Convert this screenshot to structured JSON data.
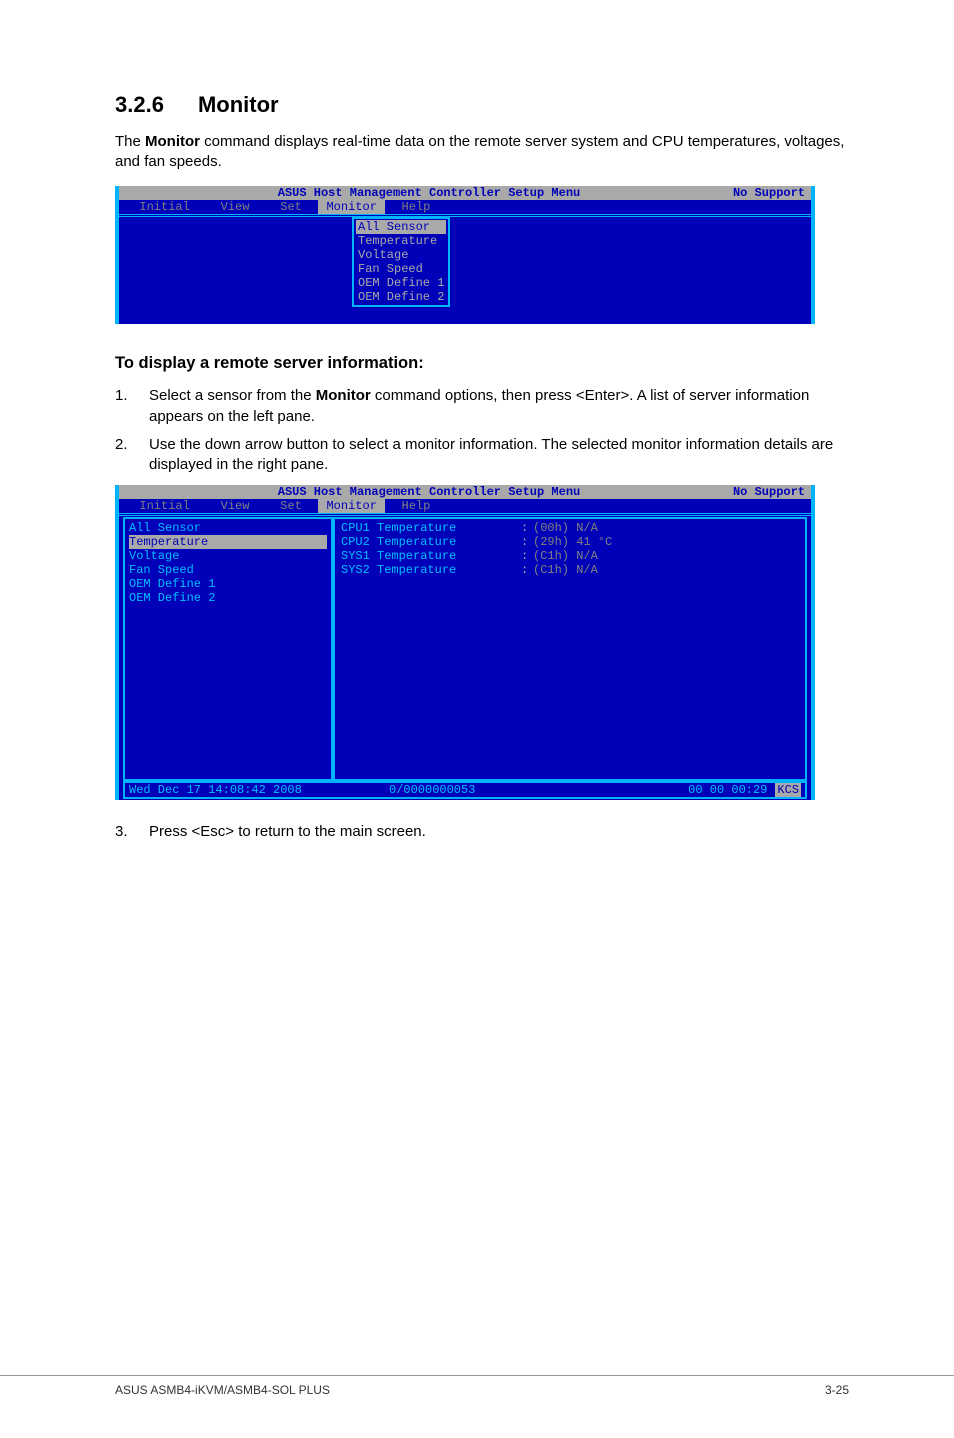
{
  "section": {
    "number": "3.2.6",
    "title": "Monitor"
  },
  "intro": {
    "prefix": "The ",
    "bold": "Monitor",
    "suffix": " command displays real-time data on the remote server system and CPU temperatures, voltages, and fan speeds."
  },
  "term_title": {
    "main": "ASUS Host Management Controller Setup Menu",
    "right": "No Support"
  },
  "menubar": {
    "items": [
      "Initial",
      "View",
      "Set",
      "Monitor",
      "Help"
    ],
    "active_index": 3
  },
  "dropdown": {
    "items": [
      "All Sensor",
      "Temperature",
      "Voltage",
      "Fan Speed",
      "OEM Define 1",
      "OEM Define 2"
    ],
    "selected_index": 0
  },
  "subheading": "To display a remote server information:",
  "steps": [
    {
      "num": "1.",
      "prefix": "Select a sensor from the ",
      "bold": "Monitor",
      "suffix": " command options, then press <Enter>. A list of server information appears on the left pane."
    },
    {
      "num": "2.",
      "prefix": "Use the down arrow button to select a monitor information. The selected monitor information details are displayed in the right pane.",
      "bold": "",
      "suffix": ""
    }
  ],
  "left_pane": {
    "items": [
      "All Sensor",
      "Temperature",
      "Voltage",
      "Fan Speed",
      "OEM Define 1",
      "OEM Define 2"
    ],
    "selected_index": 1
  },
  "right_pane": [
    {
      "label": "CPU1 Temperature",
      "value": "(00h) N/A"
    },
    {
      "label": "CPU2 Temperature",
      "value": "(29h) 41 °C"
    },
    {
      "label": "SYS1 Temperature",
      "value": "(C1h) N/A"
    },
    {
      "label": "SYS2 Temperature",
      "value": "(C1h) N/A"
    }
  ],
  "statusbar": {
    "datetime": "Wed Dec 17 14:08:42 2008",
    "counter": "0/0000000053",
    "uptime": "00 00 00:29",
    "mode": "KCS"
  },
  "step3": {
    "num": "3.",
    "text": "Press <Esc> to return to the main screen."
  },
  "footer": {
    "left": "ASUS ASMB4-iKVM/ASMB4-SOL PLUS",
    "right": "3-25"
  }
}
